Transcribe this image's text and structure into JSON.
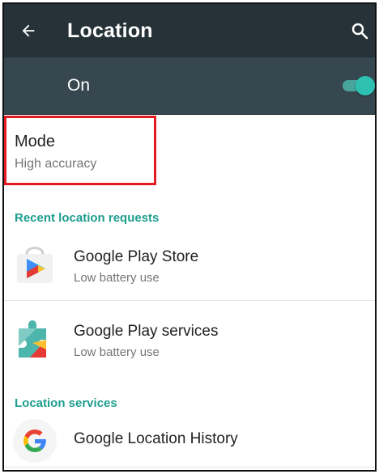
{
  "app_bar": {
    "title": "Location",
    "back_icon": "arrow-back-icon",
    "search_icon": "search-icon",
    "background": "#263238"
  },
  "master_switch": {
    "label": "On",
    "state": "on",
    "background": "#37474f",
    "accent": "#2ec1b2"
  },
  "mode": {
    "title": "Mode",
    "value": "High accuracy",
    "highlight_color": "#e21b23"
  },
  "recent_requests": {
    "header": "Recent location requests",
    "header_color": "#1e9e8e",
    "items": [
      {
        "name": "Google Play Store",
        "usage": "Low battery use",
        "icon": "play-store-icon"
      },
      {
        "name": "Google Play services",
        "usage": "Low battery use",
        "icon": "play-services-icon"
      }
    ]
  },
  "location_services": {
    "header": "Location services",
    "items": [
      {
        "name": "Google Location History",
        "icon": "google-g-icon"
      }
    ]
  }
}
